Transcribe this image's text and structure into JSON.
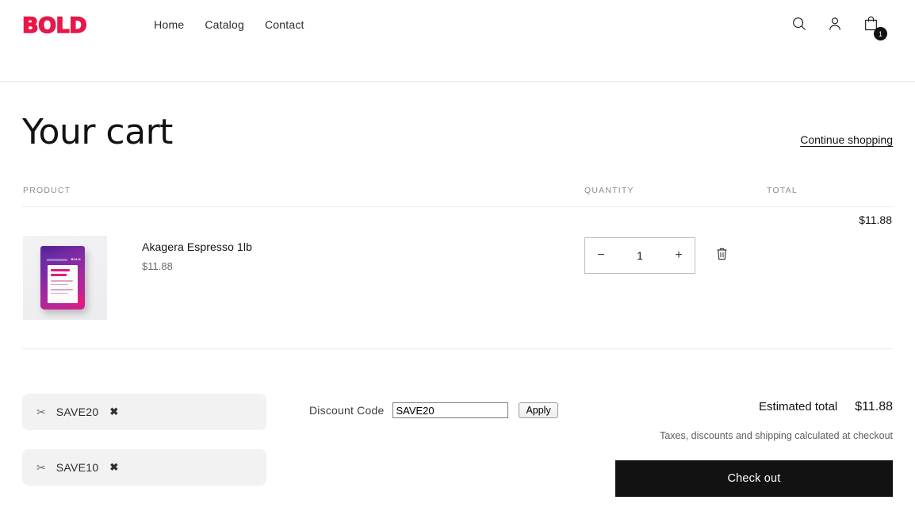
{
  "header": {
    "logo": "BOLD",
    "logo_color": "#E8174A",
    "nav": [
      {
        "label": "Home"
      },
      {
        "label": "Catalog"
      },
      {
        "label": "Contact"
      }
    ],
    "actions": {
      "search_icon": "search-icon",
      "account_icon": "user-icon",
      "cart_icon": "shopping-bag-icon",
      "cart_count": "1"
    }
  },
  "cart": {
    "title": "Your cart",
    "continue_shopping": "Continue shopping",
    "columns": {
      "product": "PRODUCT",
      "quantity": "QUANTITY",
      "total": "TOTAL"
    },
    "items": [
      {
        "title": "Akagera Espresso 1lb",
        "unit_price": "$11.88",
        "quantity": "1",
        "line_total": "$11.88",
        "decrease_label": "−",
        "increase_label": "+",
        "remove_label": "trash-icon"
      }
    ]
  },
  "discount": {
    "label": "Discount Code",
    "input_value": "SAVE20",
    "input_placeholder": "",
    "apply_label": "Apply",
    "applied_codes": [
      {
        "scissors": "✂",
        "code": "SAVE20",
        "remove": "✖"
      },
      {
        "scissors": "✂",
        "code": "SAVE10",
        "remove": "✖"
      }
    ]
  },
  "summary": {
    "estimated_total_label": "Estimated total",
    "estimated_total_value": "$11.88",
    "note": "Taxes, discounts and shipping calculated at checkout",
    "checkout_label": "Check out"
  }
}
